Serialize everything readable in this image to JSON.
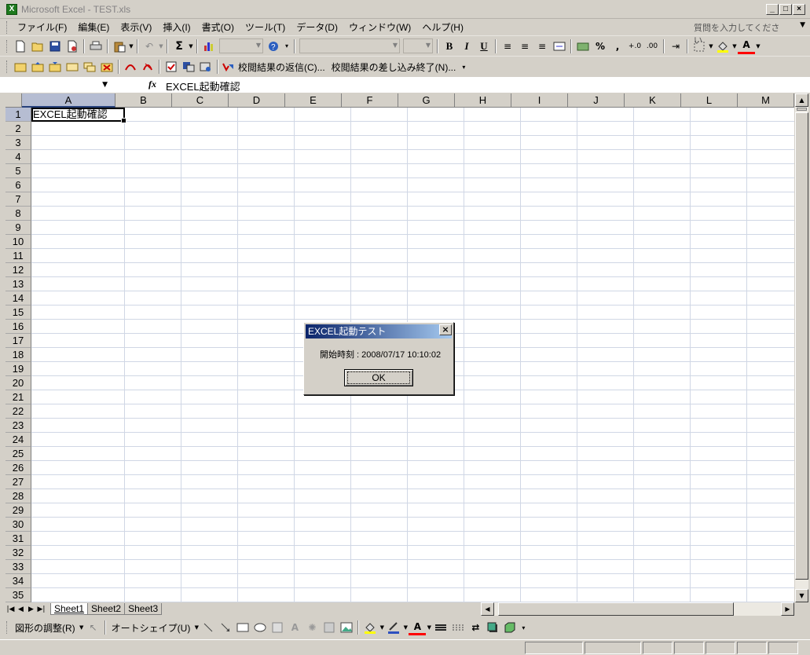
{
  "window": {
    "title": "Microsoft Excel - TEST.xls",
    "app_icon": "X",
    "min": "_",
    "max": "□",
    "close": "×"
  },
  "menu": {
    "items": [
      "ファイル(F)",
      "編集(E)",
      "表示(V)",
      "挿入(I)",
      "書式(O)",
      "ツール(T)",
      "データ(D)",
      "ウィンドウ(W)",
      "ヘルプ(H)"
    ],
    "help_placeholder": "質問を入力してください"
  },
  "toolbar2": {
    "reply_label": "校閲結果の返信(C)...",
    "end_review_label": "校閲結果の差し込み終了(N)..."
  },
  "formula_bar": {
    "name_box": "",
    "fx": "fx",
    "content": "EXCEL起動確認"
  },
  "sheet": {
    "columns": [
      "A",
      "B",
      "C",
      "D",
      "E",
      "F",
      "G",
      "H",
      "I",
      "J",
      "K",
      "L",
      "M"
    ],
    "row_count": 35,
    "selected_column": "A",
    "selected_row": 1,
    "cells": {
      "A1": "EXCEL起動確認"
    }
  },
  "tabs": [
    "Sheet1",
    "Sheet2",
    "Sheet3"
  ],
  "active_tab": "Sheet1",
  "drawing_toolbar": {
    "draw_label": "図形の調整(R)",
    "autoshape_label": "オートシェイプ(U)"
  },
  "dialog": {
    "title": "EXCEL起動テスト",
    "message": "開始時刻 : 2008/07/17 10:10:02",
    "ok_label": "OK"
  }
}
